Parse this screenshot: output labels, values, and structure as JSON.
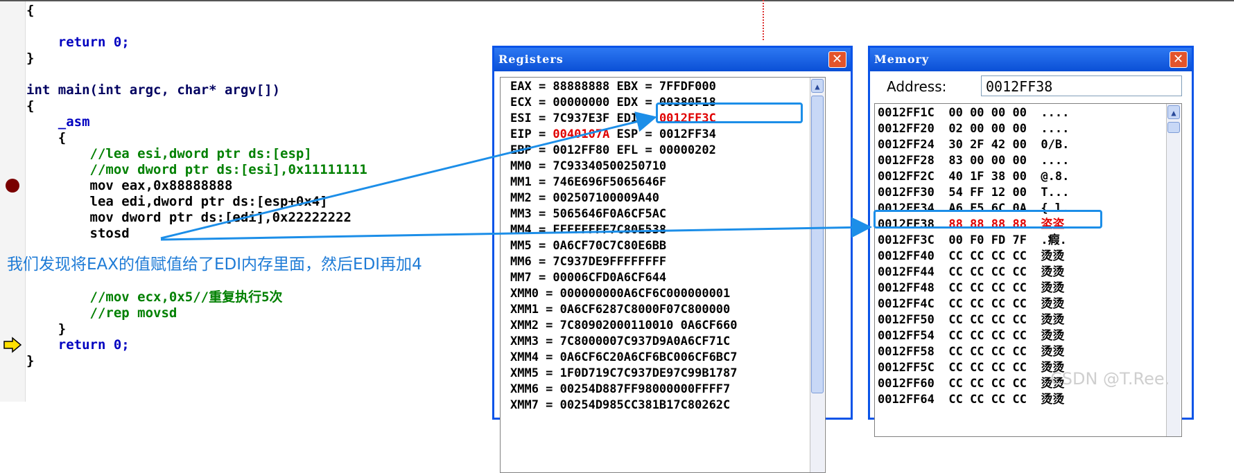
{
  "code": {
    "lines": [
      "{",
      "",
      "    return 0;",
      "}",
      "",
      "int main(int argc, char* argv[])",
      "{",
      "    _asm",
      "    {",
      "        //lea esi,dword ptr ds:[esp]",
      "        //mov dword ptr ds:[esi],0x11111111",
      "        mov eax,0x88888888",
      "        lea edi,dword ptr ds:[esp+0x4]",
      "        mov dword ptr ds:[edi],0x22222222",
      "        stosd",
      "",
      "",
      "",
      "        //mov ecx,0x5//重复执行5次",
      "        //rep movsd",
      "    }",
      "    return 0;",
      "}"
    ]
  },
  "registers": {
    "title": "Registers",
    "close_label": "✕",
    "lines": [
      "EAX = 88888888 EBX = 7FFDF000",
      "ECX = 00000000 EDX = 00380F18",
      "ESI = 7C937E3F EDI = 0012FF3C",
      "EIP = 0040107A ESP = 0012FF34",
      "EBP = 0012FF80 EFL = 00000202",
      "MM0 = 7C93340500250710",
      "MM1 = 746E696F5065646F",
      "MM2 = 002507100009A40",
      "MM3 = 5065646F0A6CF5AC",
      "MM4 = FFFFFFFF7C80E538",
      "MM5 = 0A6CF70C7C80E6BB",
      "MM6 = 7C937DE9FFFFFFFF",
      "MM7 = 00006CFD0A6CF644",
      "XMM0 = 000000000A6CF6C000000001",
      "XMM1 = 0A6CF6287C8000F07C800000",
      "XMM2 = 7C80902000110010 0A6CF660",
      "XMM3 = 7C8000007C937D9A0A6CF71C",
      "XMM4 = 0A6CF6C20A6CF6BC006CF6BC7",
      "XMM5 = 1F0D719C7C937DE97C99B1787",
      "XMM6 = 00254D887FF98000000FFFF7",
      "XMM7 = 00254D985CC381B17C80262C"
    ],
    "edi_value": "0012FF3C",
    "eip_value": "0040107A"
  },
  "memory": {
    "title": "Memory",
    "close_label": "✕",
    "address_label": "Address:",
    "address_value": "0012FF38",
    "rows": [
      {
        "addr": "0012FF1C",
        "bytes": "00 00 00 00",
        "ascii": "...."
      },
      {
        "addr": "0012FF20",
        "bytes": "02 00 00 00",
        "ascii": "...."
      },
      {
        "addr": "0012FF24",
        "bytes": "30 2F 42 00",
        "ascii": "0/B."
      },
      {
        "addr": "0012FF28",
        "bytes": "83 00 00 00",
        "ascii": "...."
      },
      {
        "addr": "0012FF2C",
        "bytes": "40 1F 38 00",
        "ascii": "@.8."
      },
      {
        "addr": "0012FF30",
        "bytes": "54 FF 12 00",
        "ascii": "T..."
      },
      {
        "addr": "0012FF34",
        "bytes": "A6 F5 6C 0A",
        "ascii": "{ l."
      },
      {
        "addr": "0012FF38",
        "bytes": "88 88 88 88",
        "ascii": "垐垐"
      },
      {
        "addr": "0012FF3C",
        "bytes": "00 F0 FD 7F",
        "ascii": ".瘕."
      },
      {
        "addr": "0012FF40",
        "bytes": "CC CC CC CC",
        "ascii": "烫烫"
      },
      {
        "addr": "0012FF44",
        "bytes": "CC CC CC CC",
        "ascii": "烫烫"
      },
      {
        "addr": "0012FF48",
        "bytes": "CC CC CC CC",
        "ascii": "烫烫"
      },
      {
        "addr": "0012FF4C",
        "bytes": "CC CC CC CC",
        "ascii": "烫烫"
      },
      {
        "addr": "0012FF50",
        "bytes": "CC CC CC CC",
        "ascii": "烫烫"
      },
      {
        "addr": "0012FF54",
        "bytes": "CC CC CC CC",
        "ascii": "烫烫"
      },
      {
        "addr": "0012FF58",
        "bytes": "CC CC CC CC",
        "ascii": "烫烫"
      },
      {
        "addr": "0012FF5C",
        "bytes": "CC CC CC CC",
        "ascii": "烫烫"
      },
      {
        "addr": "0012FF60",
        "bytes": "CC CC CC CC",
        "ascii": "烫烫"
      },
      {
        "addr": "0012FF64",
        "bytes": "CC CC CC CC",
        "ascii": "烫烫"
      }
    ],
    "highlight_address": "0012FF38"
  },
  "annotation": "我们发现将EAX的值赋值给了EDI内存里面，然后EDI再加4",
  "watermark": "CSDN @T.Ree.",
  "colors": {
    "accent": "#1c8ee8",
    "titlebar": "#0a54e8",
    "changed": "#e00000"
  }
}
